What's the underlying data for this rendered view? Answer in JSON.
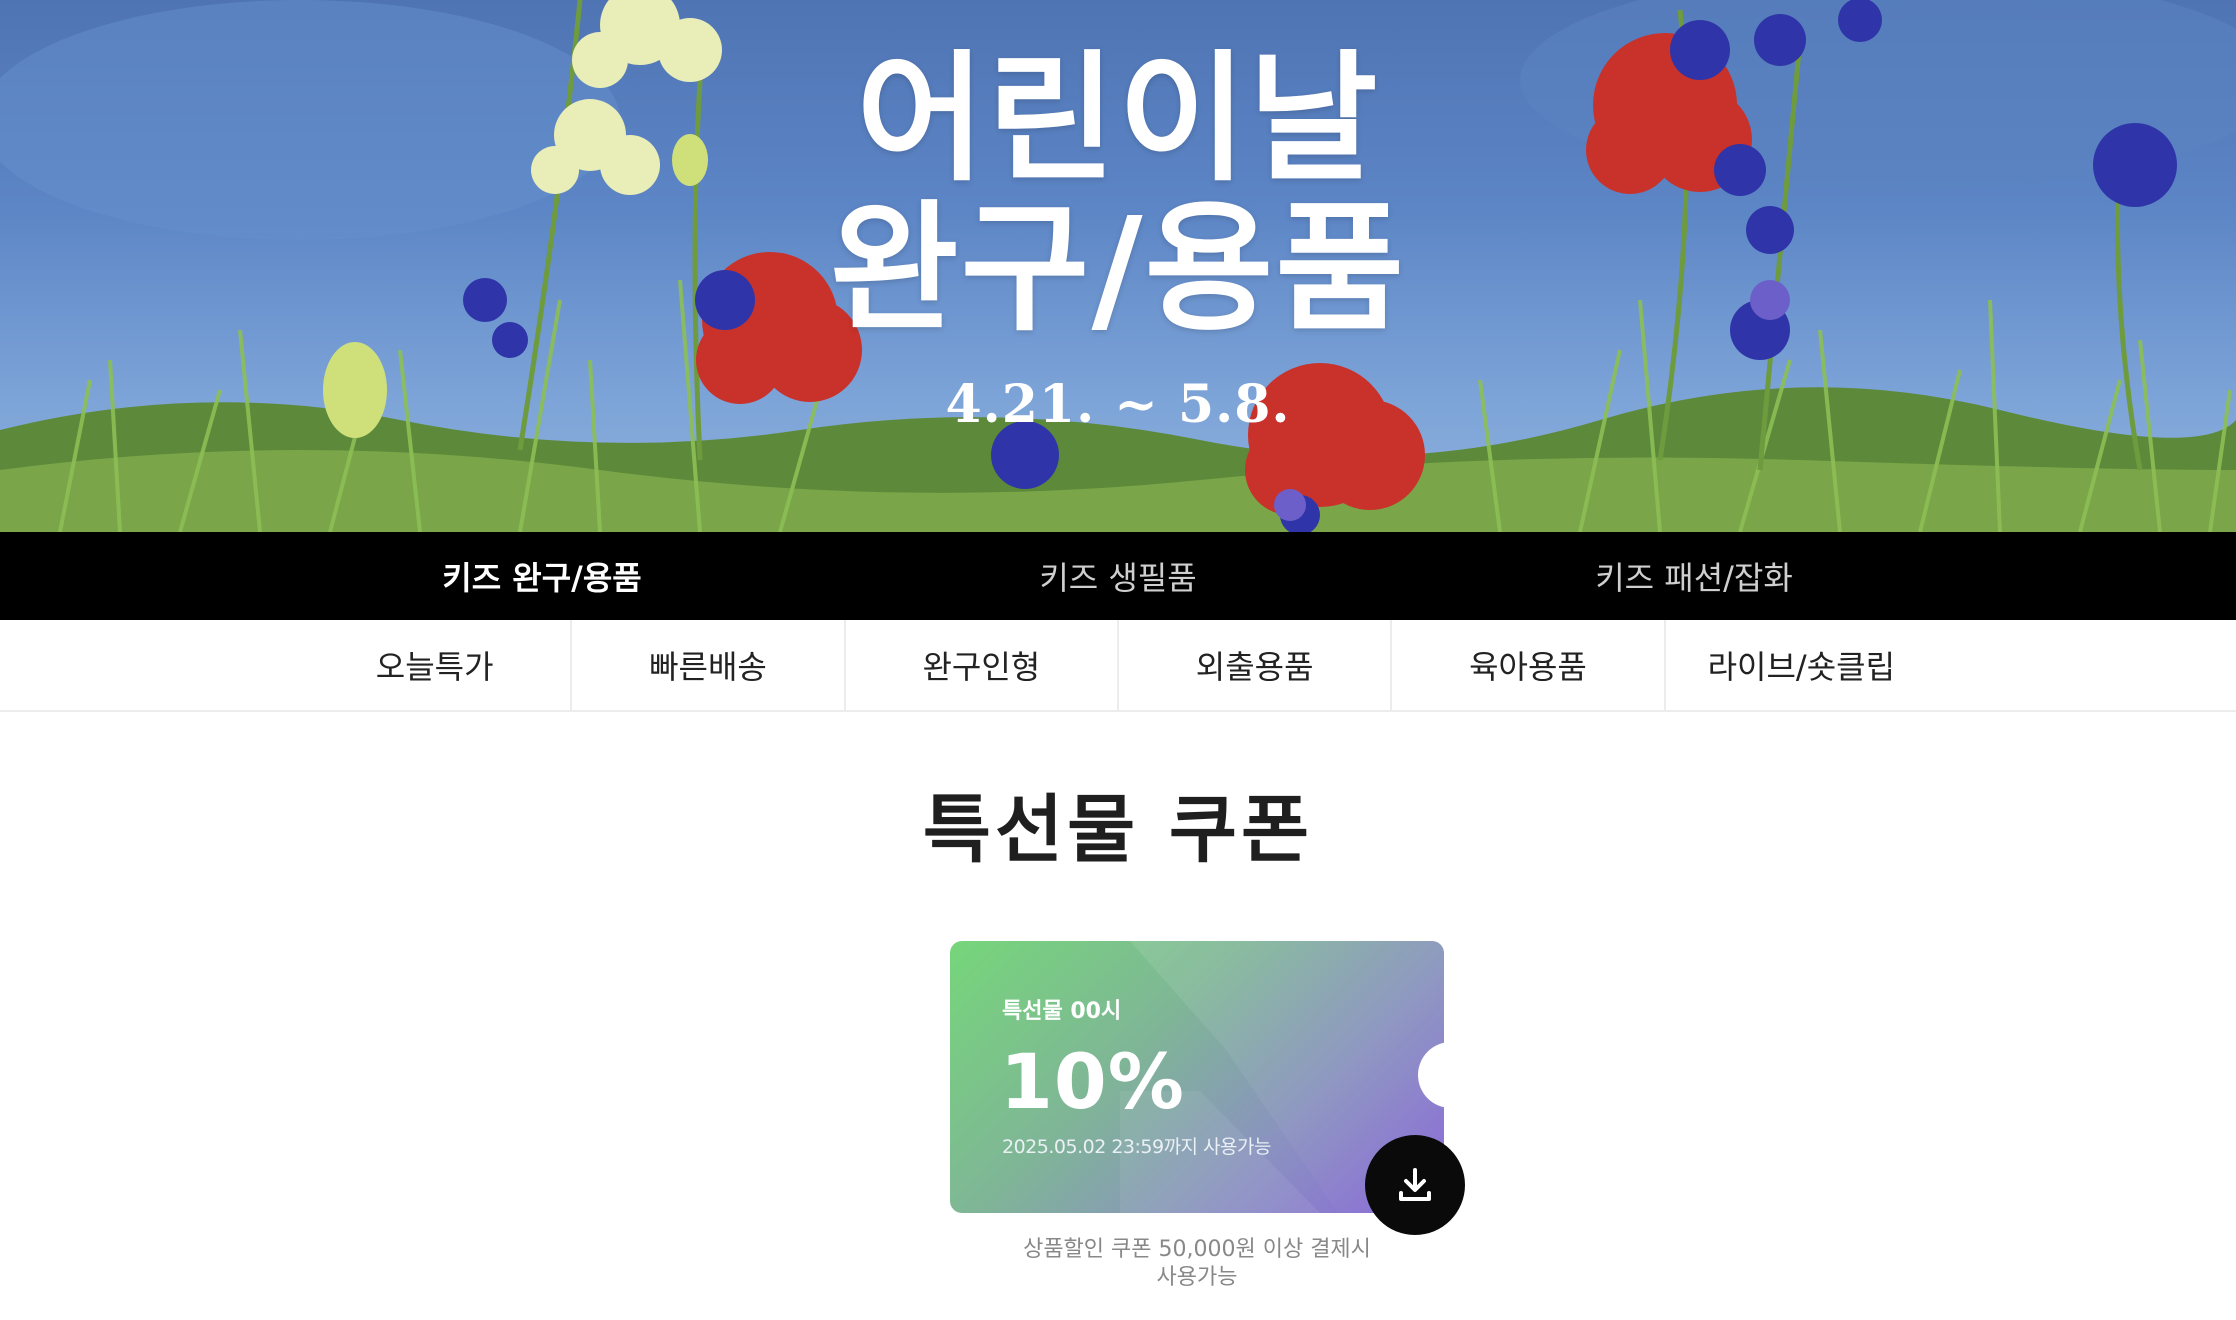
{
  "hero": {
    "title_line1": "어린이날",
    "title_line2": "완구/용품",
    "date_range": "4.21. ~ 5.8."
  },
  "main_nav": {
    "tabs": [
      {
        "label": "키즈 완구/용품",
        "active": true
      },
      {
        "label": "키즈 생필품",
        "active": false
      },
      {
        "label": "키즈 패션/잡화",
        "active": false
      }
    ]
  },
  "sub_nav": {
    "tabs": [
      {
        "label": "오늘특가"
      },
      {
        "label": "빠른배송"
      },
      {
        "label": "완구인형"
      },
      {
        "label": "외출용품"
      },
      {
        "label": "육아용품"
      },
      {
        "label": "라이브/숏클립"
      }
    ]
  },
  "section": {
    "title": "특선물 쿠폰"
  },
  "coupon": {
    "label": "특선물 00시",
    "value": "10%",
    "expiry": "2025.05.02 23:59까지 사용가능",
    "condition_line1": "상품할인 쿠폰 50,000원 이상 결제시",
    "condition_line2": "사용가능",
    "download_icon": "download-icon",
    "gradient_start": "#76d67a",
    "gradient_end": "#8b66db"
  }
}
